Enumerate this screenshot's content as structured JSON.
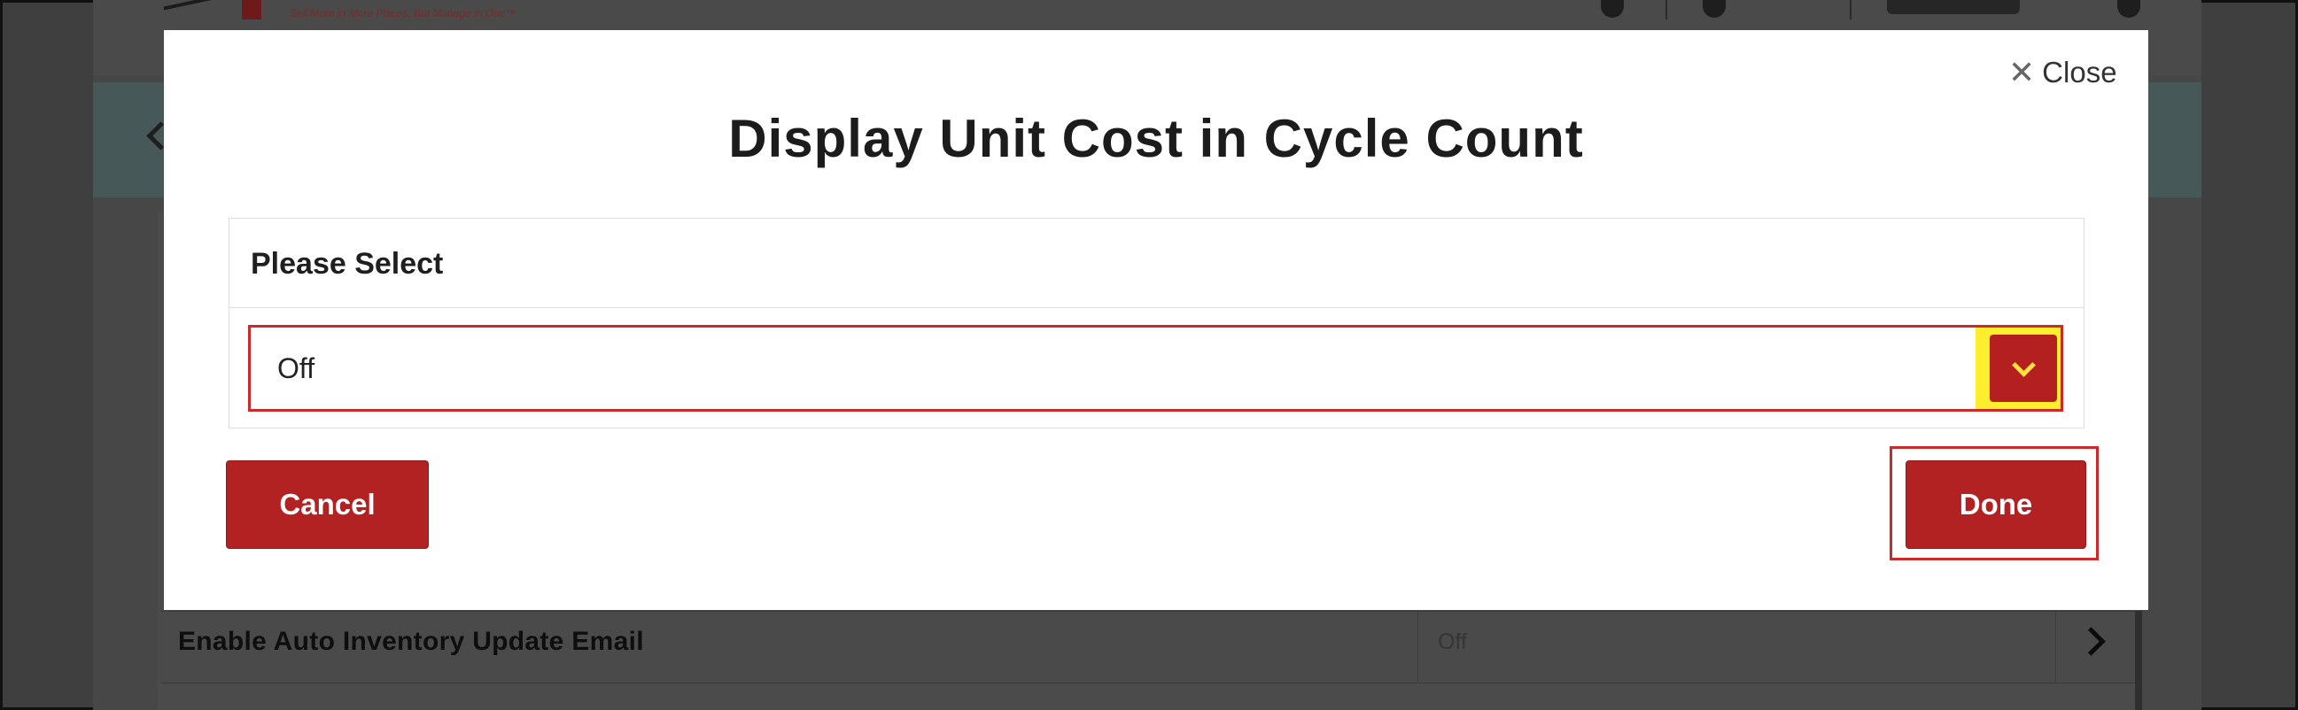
{
  "background": {
    "tagline": "Sell More in More Places. But Manage in One™",
    "row": {
      "label": "Enable Auto Inventory Update Email",
      "value": "Off"
    }
  },
  "modal": {
    "close_label": "Close",
    "close_icon": "close-x-icon",
    "title": "Display Unit Cost in Cycle Count",
    "select": {
      "label": "Please Select",
      "value": "Off",
      "icon": "chevron-down-icon"
    },
    "cancel_label": "Cancel",
    "done_label": "Done"
  },
  "colors": {
    "primary": "#b22222",
    "highlight": "#ffee2e",
    "outline": "#cc2a2a"
  }
}
